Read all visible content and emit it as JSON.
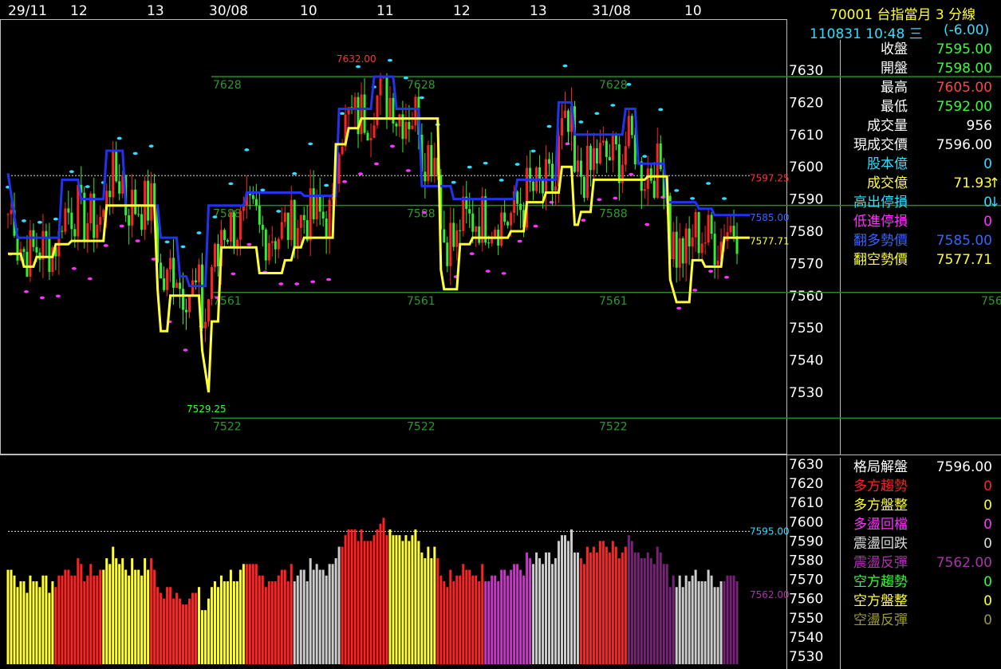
{
  "header": {
    "title": "70001  台指當月 3 分線",
    "datetime": "110831 10:48 三",
    "change": "(-6.00)"
  },
  "time_axis": [
    "29/11",
    "12",
    "13",
    "30/08",
    "10",
    "11",
    "12",
    "13",
    "31/08",
    "10"
  ],
  "info_panel": [
    {
      "label": "收盤",
      "value": "7595.00",
      "label_color": "#ffffff",
      "value_color": "#33ff33"
    },
    {
      "label": "開盤",
      "value": "7598.00",
      "label_color": "#ffffff",
      "value_color": "#33ff33"
    },
    {
      "label": "最高",
      "value": "7605.00",
      "label_color": "#ffffff",
      "value_color": "#ff4444"
    },
    {
      "label": "最低",
      "value": "7592.00",
      "label_color": "#ffffff",
      "value_color": "#33ff33"
    },
    {
      "label": "成交量",
      "value": "956",
      "label_color": "#ffffff",
      "value_color": "#ffffff"
    },
    {
      "label": "現成交價",
      "value": "7596.00",
      "label_color": "#ffffff",
      "value_color": "#ffffff"
    },
    {
      "label": "股本億",
      "value": "0",
      "label_color": "#33ddff",
      "value_color": "#33ddff"
    },
    {
      "label": "成交億",
      "value": "71.93",
      "label_color": "#ffff33",
      "value_color": "#ffff33",
      "arrow": "↑",
      "arrow_color": "#ffff33"
    },
    {
      "label": "高出停損",
      "value": "0",
      "label_color": "#33ddff",
      "value_color": "#33ddff",
      "arrow": "↓",
      "arrow_color": "#33ddff"
    },
    {
      "label": "低進停損",
      "value": "0",
      "label_color": "#ff33ff",
      "value_color": "#ff33ff"
    },
    {
      "label": "翻多勢價",
      "value": "7585.00",
      "label_color": "#3366ff",
      "value_color": "#3366ff"
    },
    {
      "label": "翻空勢價",
      "value": "7577.71",
      "label_color": "#ffff33",
      "value_color": "#ffff33"
    }
  ],
  "lower_panel": [
    {
      "label": "格局解盤",
      "value": "7596.00",
      "label_color": "#ffffff",
      "value_color": "#ffffff"
    },
    {
      "label": "多方趨勢",
      "value": "0",
      "label_color": "#ff2222",
      "value_color": "#ff2222"
    },
    {
      "label": "多方盤整",
      "value": "0",
      "label_color": "#ffff33",
      "value_color": "#ffff33"
    },
    {
      "label": "多盪回檔",
      "value": "0",
      "label_color": "#ff33ff",
      "value_color": "#ff33ff"
    },
    {
      "label": "震盪回跌",
      "value": "0",
      "label_color": "#dddddd",
      "value_color": "#dddddd"
    },
    {
      "label": "震盪反彈",
      "value": "7562.00",
      "label_color": "#aa33aa",
      "value_color": "#aa33aa"
    },
    {
      "label": "空方趨勢",
      "value": "0",
      "label_color": "#33ff33",
      "value_color": "#33ff33"
    },
    {
      "label": "空方盤整",
      "value": "0",
      "label_color": "#ffff33",
      "value_color": "#ffff33"
    },
    {
      "label": "空盪反彈",
      "value": "0",
      "label_color": "#999933",
      "value_color": "#999933"
    }
  ],
  "chart_data": [
    {
      "type": "candlestick",
      "panel": "upper",
      "y_ticks": [
        7530,
        7540,
        7550,
        7560,
        7570,
        7580,
        7590,
        7600,
        7610,
        7620,
        7630
      ],
      "ylim": [
        7520,
        7638
      ],
      "levels": [
        {
          "value": 7628,
          "label": "7628"
        },
        {
          "value": 7588,
          "label": "7588"
        },
        {
          "value": 7561,
          "label": "7561"
        },
        {
          "value": 7522,
          "label": "7522"
        }
      ],
      "level_label_extra": "756",
      "annotations": [
        {
          "text": "7632.00",
          "value": 7632,
          "color": "#ff3333"
        },
        {
          "text": "7529.25",
          "value": 7529.25,
          "color": "#33ff33"
        },
        {
          "text": "7597.25",
          "value": 7597.25,
          "color": "#ff3333"
        },
        {
          "text": "7585.00",
          "value": 7585,
          "color": "#3366ff"
        },
        {
          "text": "7577.71",
          "value": 7577.71,
          "color": "#ffff33"
        }
      ],
      "reference_price": 7597.25,
      "blue_line": [
        [
          0,
          7598
        ],
        [
          3,
          7578
        ],
        [
          16,
          7578
        ],
        [
          17,
          7596
        ],
        [
          22,
          7596
        ],
        [
          23,
          7590
        ],
        [
          30,
          7590
        ],
        [
          31,
          7605
        ],
        [
          36,
          7605
        ],
        [
          37,
          7588
        ],
        [
          47,
          7588
        ],
        [
          48,
          7578
        ],
        [
          53,
          7578
        ],
        [
          54,
          7566
        ],
        [
          56,
          7566
        ],
        [
          57,
          7563
        ],
        [
          62,
          7563
        ],
        [
          63,
          7588
        ],
        [
          74,
          7588
        ],
        [
          75,
          7592
        ],
        [
          92,
          7592
        ],
        [
          93,
          7591
        ],
        [
          103,
          7591
        ],
        [
          104,
          7618
        ],
        [
          114,
          7618
        ],
        [
          115,
          7628
        ],
        [
          121,
          7628
        ],
        [
          122,
          7618
        ],
        [
          129,
          7618
        ],
        [
          130,
          7594
        ],
        [
          139,
          7594
        ],
        [
          140,
          7590
        ],
        [
          159,
          7590
        ],
        [
          160,
          7596
        ],
        [
          172,
          7596
        ],
        [
          173,
          7620
        ],
        [
          177,
          7620
        ],
        [
          178,
          7610
        ],
        [
          193,
          7610
        ],
        [
          194,
          7618
        ],
        [
          197,
          7618
        ],
        [
          198,
          7601
        ],
        [
          206,
          7601
        ],
        [
          207,
          7589
        ],
        [
          216,
          7589
        ],
        [
          217,
          7587
        ],
        [
          221,
          7587
        ],
        [
          222,
          7585
        ],
        [
          233,
          7585
        ]
      ],
      "yellow_line": [
        [
          0,
          7573
        ],
        [
          4,
          7573
        ],
        [
          5,
          7569
        ],
        [
          8,
          7569
        ],
        [
          9,
          7572
        ],
        [
          14,
          7572
        ],
        [
          15,
          7576
        ],
        [
          19,
          7576
        ],
        [
          20,
          7577
        ],
        [
          30,
          7577
        ],
        [
          31,
          7588
        ],
        [
          46,
          7588
        ],
        [
          47,
          7562
        ],
        [
          48,
          7549
        ],
        [
          50,
          7549
        ],
        [
          51,
          7560
        ],
        [
          60,
          7560
        ],
        [
          61,
          7543
        ],
        [
          63,
          7530
        ],
        [
          64,
          7552
        ],
        [
          66,
          7552
        ],
        [
          67,
          7575
        ],
        [
          78,
          7575
        ],
        [
          79,
          7567
        ],
        [
          86,
          7567
        ],
        [
          87,
          7571
        ],
        [
          89,
          7571
        ],
        [
          90,
          7575
        ],
        [
          92,
          7575
        ],
        [
          93,
          7578
        ],
        [
          98,
          7578
        ],
        [
          99,
          7578
        ],
        [
          102,
          7578
        ],
        [
          103,
          7607
        ],
        [
          106,
          7607
        ],
        [
          107,
          7612
        ],
        [
          110,
          7612
        ],
        [
          111,
          7615
        ],
        [
          135,
          7615
        ],
        [
          136,
          7568
        ],
        [
          137,
          7562
        ],
        [
          141,
          7562
        ],
        [
          142,
          7576
        ],
        [
          145,
          7576
        ],
        [
          146,
          7578
        ],
        [
          157,
          7578
        ],
        [
          158,
          7580
        ],
        [
          162,
          7580
        ],
        [
          163,
          7589
        ],
        [
          168,
          7589
        ],
        [
          169,
          7592
        ],
        [
          173,
          7592
        ],
        [
          174,
          7600
        ],
        [
          177,
          7600
        ],
        [
          178,
          7582
        ],
        [
          179,
          7582
        ],
        [
          180,
          7586
        ],
        [
          183,
          7586
        ],
        [
          184,
          7596
        ],
        [
          200,
          7596
        ],
        [
          201,
          7597
        ],
        [
          207,
          7597
        ],
        [
          208,
          7565
        ],
        [
          210,
          7558
        ],
        [
          214,
          7558
        ],
        [
          215,
          7571
        ],
        [
          218,
          7571
        ],
        [
          219,
          7569
        ],
        [
          224,
          7569
        ],
        [
          225,
          7578
        ],
        [
          233,
          7578
        ]
      ],
      "candles_summary": "230 three-minute candles spanning 29/11 through 31/08 10:48"
    },
    {
      "type": "bar",
      "panel": "lower",
      "y_ticks": [
        7530,
        7540,
        7550,
        7560,
        7570,
        7580,
        7590,
        7600,
        7610,
        7620,
        7630
      ],
      "ylim": [
        7525,
        7634
      ],
      "reference_price": 7595.0,
      "annotations": [
        {
          "text": "7595.00",
          "value": 7595,
          "color": "#33ddff"
        },
        {
          "text": "7562.00",
          "value": 7562,
          "color": "#aa33aa"
        }
      ]
    }
  ]
}
